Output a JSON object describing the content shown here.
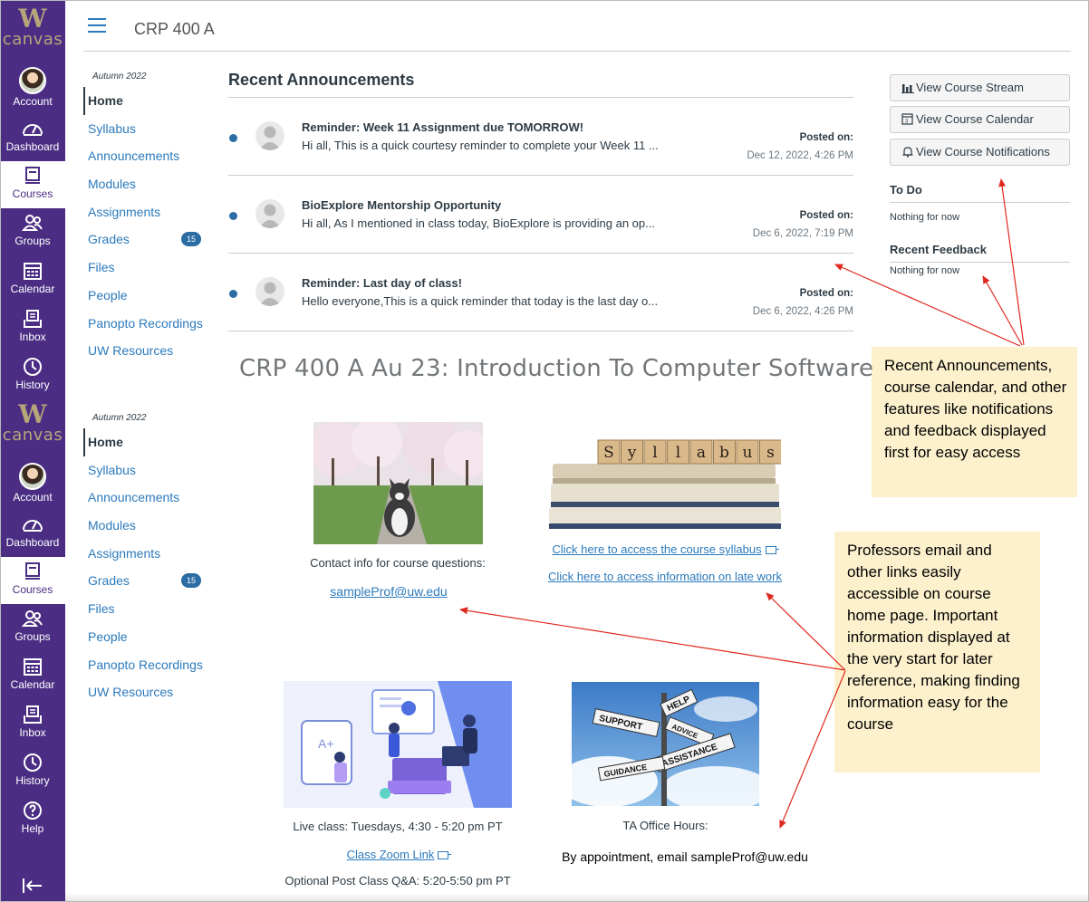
{
  "global_nav": {
    "logo_letter": "W",
    "logo_text": "canvas",
    "items": [
      "Account",
      "Dashboard",
      "Courses",
      "Groups",
      "Calendar",
      "Inbox",
      "History"
    ],
    "help": "Help"
  },
  "header": {
    "breadcrumb": "CRP 400 A"
  },
  "course_nav": {
    "term": "Autumn 2022",
    "items": [
      "Home",
      "Syllabus",
      "Announcements",
      "Modules",
      "Assignments",
      "Grades",
      "Files",
      "People",
      "Panopto Recordings",
      "UW Resources"
    ],
    "grades_badge": "15"
  },
  "announcements": {
    "title": "Recent Announcements",
    "posted_label": "Posted on:",
    "items": [
      {
        "title": "Reminder: Week 11 Assignment due TOMORROW!",
        "message": "Hi all, This is a quick courtesy reminder to complete your Week 11 ...",
        "date": "Dec 12, 2022, 4:26 PM"
      },
      {
        "title": "BioExplore Mentorship Opportunity",
        "message": "Hi all, As I mentioned in class today, BioExplore is providing an op...",
        "date": "Dec 6, 2022, 7:19 PM"
      },
      {
        "title": "Reminder: Last day of class!",
        "message": "Hello everyone,This is a quick reminder that today is the last day o...",
        "date": "Dec 6, 2022, 4:26 PM"
      }
    ]
  },
  "sidebar": {
    "buttons": [
      "View Course Stream",
      "View Course Calendar",
      "View Course Notifications"
    ],
    "todo_title": "To Do",
    "todo_text": "Nothing for now",
    "feedback_title": "Recent Feedback",
    "feedback_text": "Nothing for now"
  },
  "callouts": {
    "top": "Recent Announcements, course calendar, and other features like notifications and feedback displayed first for easy access",
    "bottom": "Professors email and other links easily accessible on course home page. Important information displayed at the very start for later reference, making finding information easy for the course"
  },
  "content": {
    "title": "CRP 400 A Au 23: Introduction To Computer Software",
    "contact_label": "Contact info for course questions:",
    "email": "sampleProf@uw.edu",
    "syllabus_link": "Click here to access the course syllabus",
    "late_work_link": "Click here to access information on late work",
    "live_class": "Live class: Tuesdays, 4:30 - 5:20 pm PT",
    "zoom_link": "Class Zoom Link",
    "qa": "Optional Post Class Q&A: 5:20-5:50 pm PT",
    "ta_label": "TA Office Hours:",
    "ta_text": "By appointment, email sampleProf@uw.edu",
    "syllabus_letters": [
      "S",
      "y",
      "l",
      "l",
      "a",
      "b",
      "u",
      "s"
    ],
    "sign_words": [
      "HELP",
      "SUPPORT",
      "ADVICE",
      "ASSISTANCE",
      "GUIDANCE"
    ]
  },
  "colors": {
    "nav_purple": "#4b2e83",
    "link_blue": "#2b7abc",
    "callout_bg": "#fdf1cd",
    "arrow_red": "#e0281e"
  }
}
